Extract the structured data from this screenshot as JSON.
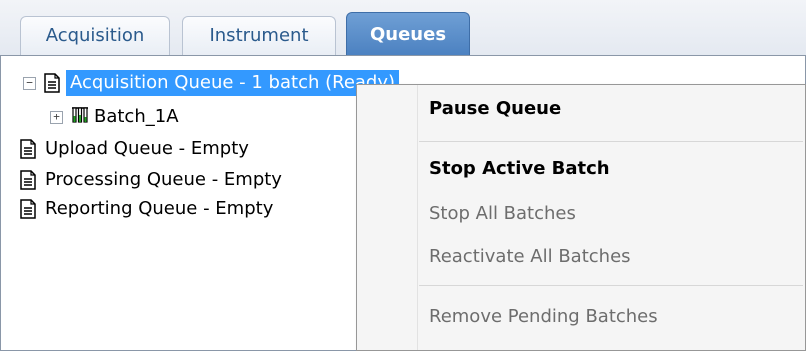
{
  "tabs": [
    {
      "label": "Acquisition",
      "active": false
    },
    {
      "label": "Instrument",
      "active": false
    },
    {
      "label": "Queues",
      "active": true
    }
  ],
  "tree": {
    "acquisition_queue": "Acquisition Queue - 1 batch (Ready)",
    "batch": "Batch_1A",
    "upload_queue": "Upload Queue - Empty",
    "processing_queue": "Processing Queue - Empty",
    "reporting_queue": "Reporting Queue - Empty"
  },
  "context_menu": {
    "pause_queue": "Pause Queue",
    "stop_active_batch": "Stop Active Batch",
    "stop_all_batches": "Stop All Batches",
    "reactivate_all_batches": "Reactivate All Batches",
    "remove_pending_batches": "Remove Pending Batches"
  },
  "icons": {
    "expand_collapse": "minus-box",
    "expand": "plus-box",
    "queue": "document-icon",
    "batch": "test-tubes-icon"
  },
  "colors": {
    "selection": "#3399ff",
    "active_tab": "#4a80c0",
    "tab_text": "#2a5a8c",
    "disabled_text": "#6d6d6d"
  }
}
